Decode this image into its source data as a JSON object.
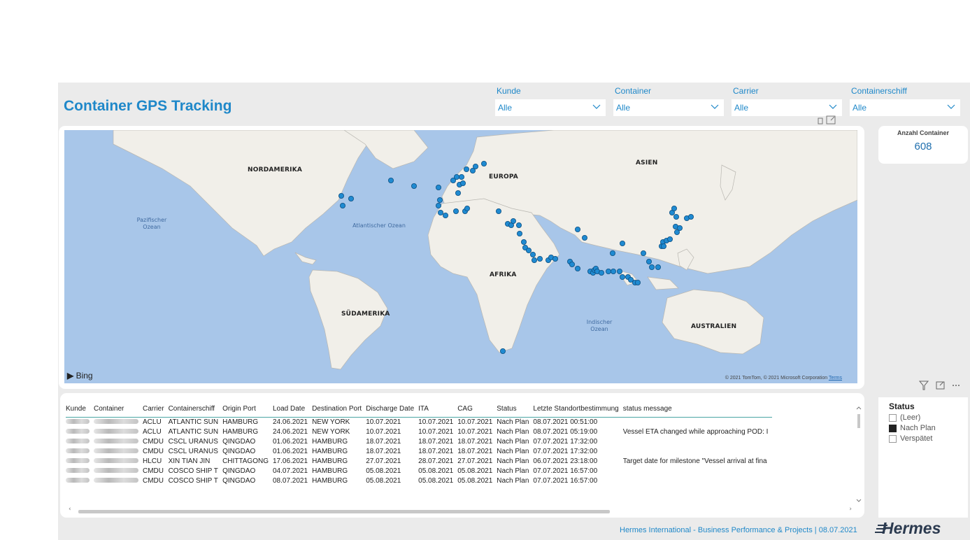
{
  "header": {
    "title": "Container GPS Tracking"
  },
  "slicers": [
    {
      "label": "Kunde",
      "value": "Alle"
    },
    {
      "label": "Container",
      "value": "Alle"
    },
    {
      "label": "Carrier",
      "value": "Alle"
    },
    {
      "label": "Containerschiff",
      "value": "Alle"
    }
  ],
  "map": {
    "continents": [
      "NORDAMERIKA",
      "EUROPA",
      "ASIEN",
      "AFRIKA",
      "SÜDAMERIKA",
      "AUSTRALIEN"
    ],
    "oceans": [
      "Pazifischer Ozean",
      "Atlantischer Ozean",
      "Indischer Ozean"
    ],
    "provider": "Bing",
    "copyright": "© 2021 TomTom, © 2021 Microsoft Corporation",
    "terms_label": "Terms",
    "point_color": "#1f8ad1"
  },
  "kpi": {
    "title": "Anzahl Container",
    "value": "608"
  },
  "table": {
    "columns": [
      "Kunde",
      "Container",
      "Carrier",
      "Containerschiff",
      "Origin Port",
      "Load Date",
      "Destination Port",
      "Discharge Date",
      "ITA",
      "CAG",
      "Status",
      "Letzte Standortbestimmung",
      "status message"
    ],
    "rows": [
      [
        "",
        "",
        "ACLU",
        "ATLANTIC SUN",
        "HAMBURG",
        "24.06.2021",
        "NEW YORK",
        "10.07.2021",
        "10.07.2021",
        "10.07.2021",
        "Nach Plan",
        "08.07.2021 00:51:00",
        ""
      ],
      [
        "",
        "",
        "ACLU",
        "ATLANTIC SUN",
        "HAMBURG",
        "24.06.2021",
        "NEW YORK",
        "10.07.2021",
        "10.07.2021",
        "10.07.2021",
        "Nach Plan",
        "08.07.2021 05:19:00",
        "Vessel ETA changed while approaching POD: I"
      ],
      [
        "",
        "",
        "CMDU",
        "CSCL URANUS",
        "QINGDAO",
        "01.06.2021",
        "HAMBURG",
        "18.07.2021",
        "18.07.2021",
        "18.07.2021",
        "Nach Plan",
        "07.07.2021 17:32:00",
        ""
      ],
      [
        "",
        "",
        "CMDU",
        "CSCL URANUS",
        "QINGDAO",
        "01.06.2021",
        "HAMBURG",
        "18.07.2021",
        "18.07.2021",
        "18.07.2021",
        "Nach Plan",
        "07.07.2021 17:32:00",
        ""
      ],
      [
        "",
        "",
        "HLCU",
        "XIN TIAN JIN",
        "CHITTAGONG",
        "17.06.2021",
        "HAMBURG",
        "27.07.2021",
        "28.07.2021",
        "27.07.2021",
        "Nach Plan",
        "06.07.2021 23:18:00",
        "Target date for milestone \"Vessel arrival at fina"
      ],
      [
        "",
        "",
        "CMDU",
        "COSCO SHIP T",
        "QINGDAO",
        "04.07.2021",
        "HAMBURG",
        "05.08.2021",
        "05.08.2021",
        "05.08.2021",
        "Nach Plan",
        "07.07.2021 16:57:00",
        ""
      ],
      [
        "",
        "",
        "CMDU",
        "COSCO SHIP T",
        "QINGDAO",
        "08.07.2021",
        "HAMBURG",
        "05.08.2021",
        "05.08.2021",
        "05.08.2021",
        "Nach Plan",
        "07.07.2021 16:57:00",
        ""
      ]
    ]
  },
  "status_filter": {
    "title": "Status",
    "items": [
      {
        "label": "(Leer)",
        "checked": false
      },
      {
        "label": "Nach Plan",
        "checked": true
      },
      {
        "label": "Verspätet",
        "checked": false
      }
    ]
  },
  "footer": {
    "text": "Hermes International - Business Performance & Projects  |  08.07.2021",
    "logo": "Hermes"
  }
}
